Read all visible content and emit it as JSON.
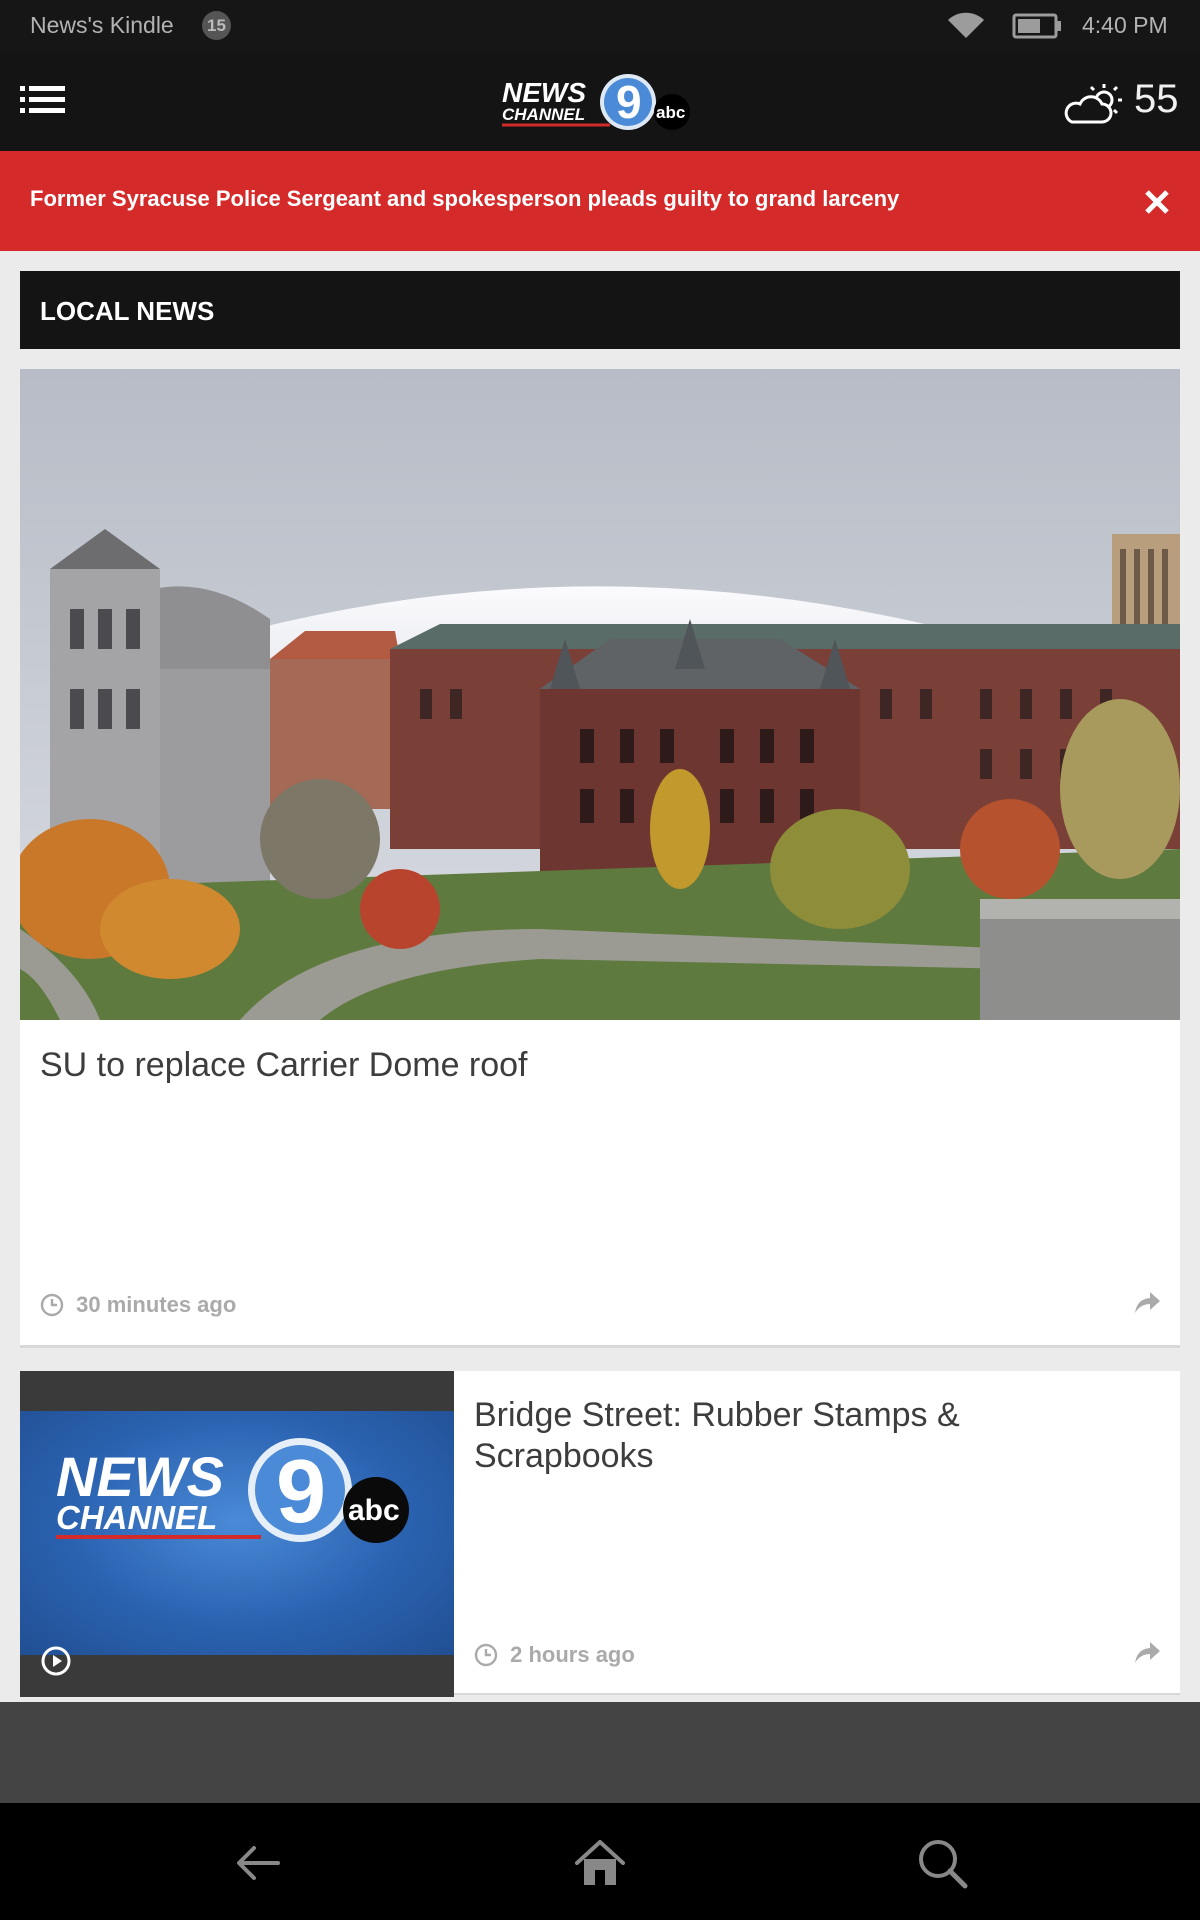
{
  "status_bar": {
    "device_name": "News's Kindle",
    "notification_count": "15",
    "time": "4:40 PM"
  },
  "header": {
    "logo_alt": "NEWS CHANNEL 9 abc",
    "logo_line1": "NEWS",
    "logo_line2": "CHANNEL",
    "logo_number": "9",
    "logo_network": "abc",
    "weather_icon": "partly-cloudy-icon",
    "temperature": "55"
  },
  "breaking": {
    "headline": "Former Syracuse Police Sergeant and spokesperson pleads guilty to grand larceny",
    "close_icon": "close-icon"
  },
  "section": {
    "title": "LOCAL NEWS"
  },
  "articles": [
    {
      "title": "SU to replace Carrier Dome roof",
      "time": "30 minutes ago",
      "image": "carrier-dome-campus-photo"
    },
    {
      "title": "Bridge Street:  Rubber Stamps & Scrapbooks",
      "time": "2 hours ago",
      "image": "news-channel-9-logo-video-thumbnail",
      "video": true
    }
  ],
  "nav": {
    "back_icon": "back-arrow-icon",
    "home_icon": "home-icon",
    "search_icon": "search-icon"
  },
  "colors": {
    "breaking_red": "#d52a2a",
    "header_black": "#141414",
    "background_gray": "#ebebeb",
    "thumbnail_blue": "#2a62b0"
  }
}
